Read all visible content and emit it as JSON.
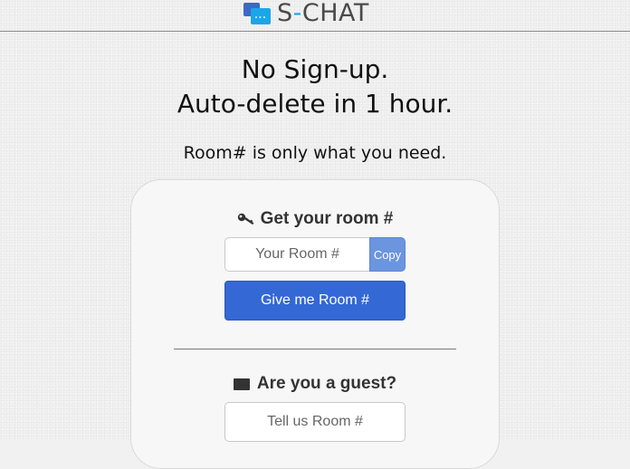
{
  "header": {
    "logo_text_prefix": "S",
    "logo_text_dash": "-",
    "logo_text_suffix": "CHAT",
    "logo_icon_glyph": "...",
    "logo_icon_name": "chat-bubbles-icon"
  },
  "hero": {
    "line1": "No Sign-up.",
    "line2": "Auto-delete in 1 hour.",
    "subline": "Room# is only what you need."
  },
  "get_room": {
    "title": "Get your room #",
    "icon_name": "key-icon",
    "room_input_placeholder": "Your Room #",
    "room_input_value": "",
    "copy_label": "Copy",
    "give_label": "Give me Room #"
  },
  "guest": {
    "title": "Are you a guest?",
    "icon_name": "envelope-icon",
    "room_input_placeholder": "Tell us Room #",
    "room_input_value": ""
  },
  "colors": {
    "primary_button": "#3468d4",
    "copy_button": "#6b95de",
    "logo_accent": "#1ba6e8",
    "logo_dark": "#3b69c8"
  }
}
